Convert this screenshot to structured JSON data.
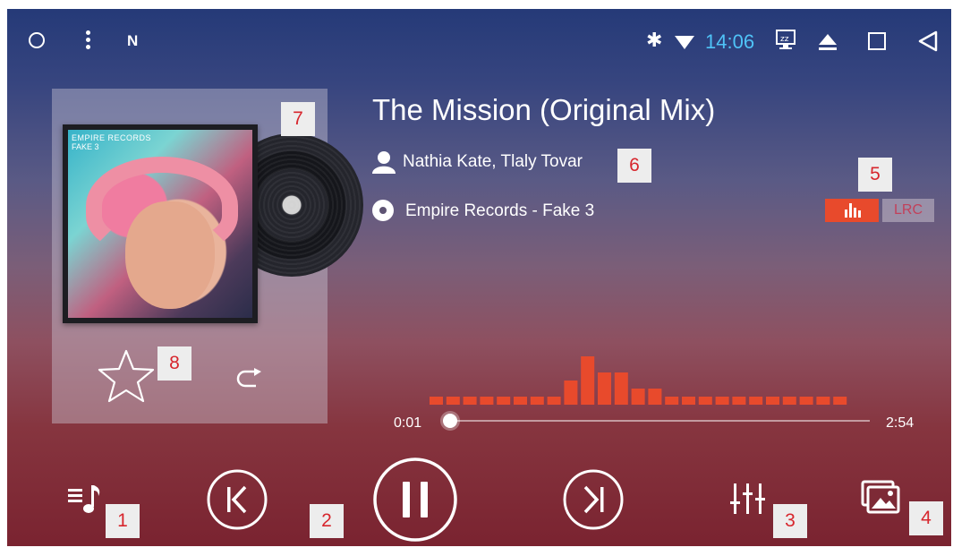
{
  "status_bar": {
    "time": "14:06",
    "icons": [
      "home-circle-icon",
      "menu-dots-icon",
      "n-notification-icon",
      "bluetooth-icon",
      "wifi-icon",
      "sleep-display-icon",
      "eject-icon",
      "recents-square-icon",
      "back-triangle-icon"
    ]
  },
  "album_card": {
    "cover_text_line1": "EMPIRE RECORDS",
    "cover_text_line2": "FAKE 3"
  },
  "track": {
    "title": "The Mission (Original Mix)",
    "artist": "Nathia Kate, Tlaly Tovar",
    "album": "Empire Records - Fake 3"
  },
  "buttons": {
    "visualizer": "visualizer-bars-icon",
    "lrc_label": "LRC"
  },
  "playback": {
    "elapsed": "0:01",
    "duration": "2:54",
    "progress_fraction": 0.006,
    "state": "playing"
  },
  "spectrum_levels": [
    1,
    1,
    1,
    1,
    1,
    1,
    1,
    1,
    3,
    6,
    4,
    4,
    2,
    2,
    1,
    1,
    1,
    1,
    1,
    1,
    1,
    1,
    1,
    1,
    1
  ],
  "badges": {
    "b1": "1",
    "b2": "2",
    "b3": "3",
    "b4": "4",
    "b5": "5",
    "b6": "6",
    "b7": "7",
    "b8": "8"
  },
  "colors": {
    "accent_red": "#e84a2c",
    "clock_blue": "#4fc3f7",
    "badge_text": "#d7262d"
  }
}
